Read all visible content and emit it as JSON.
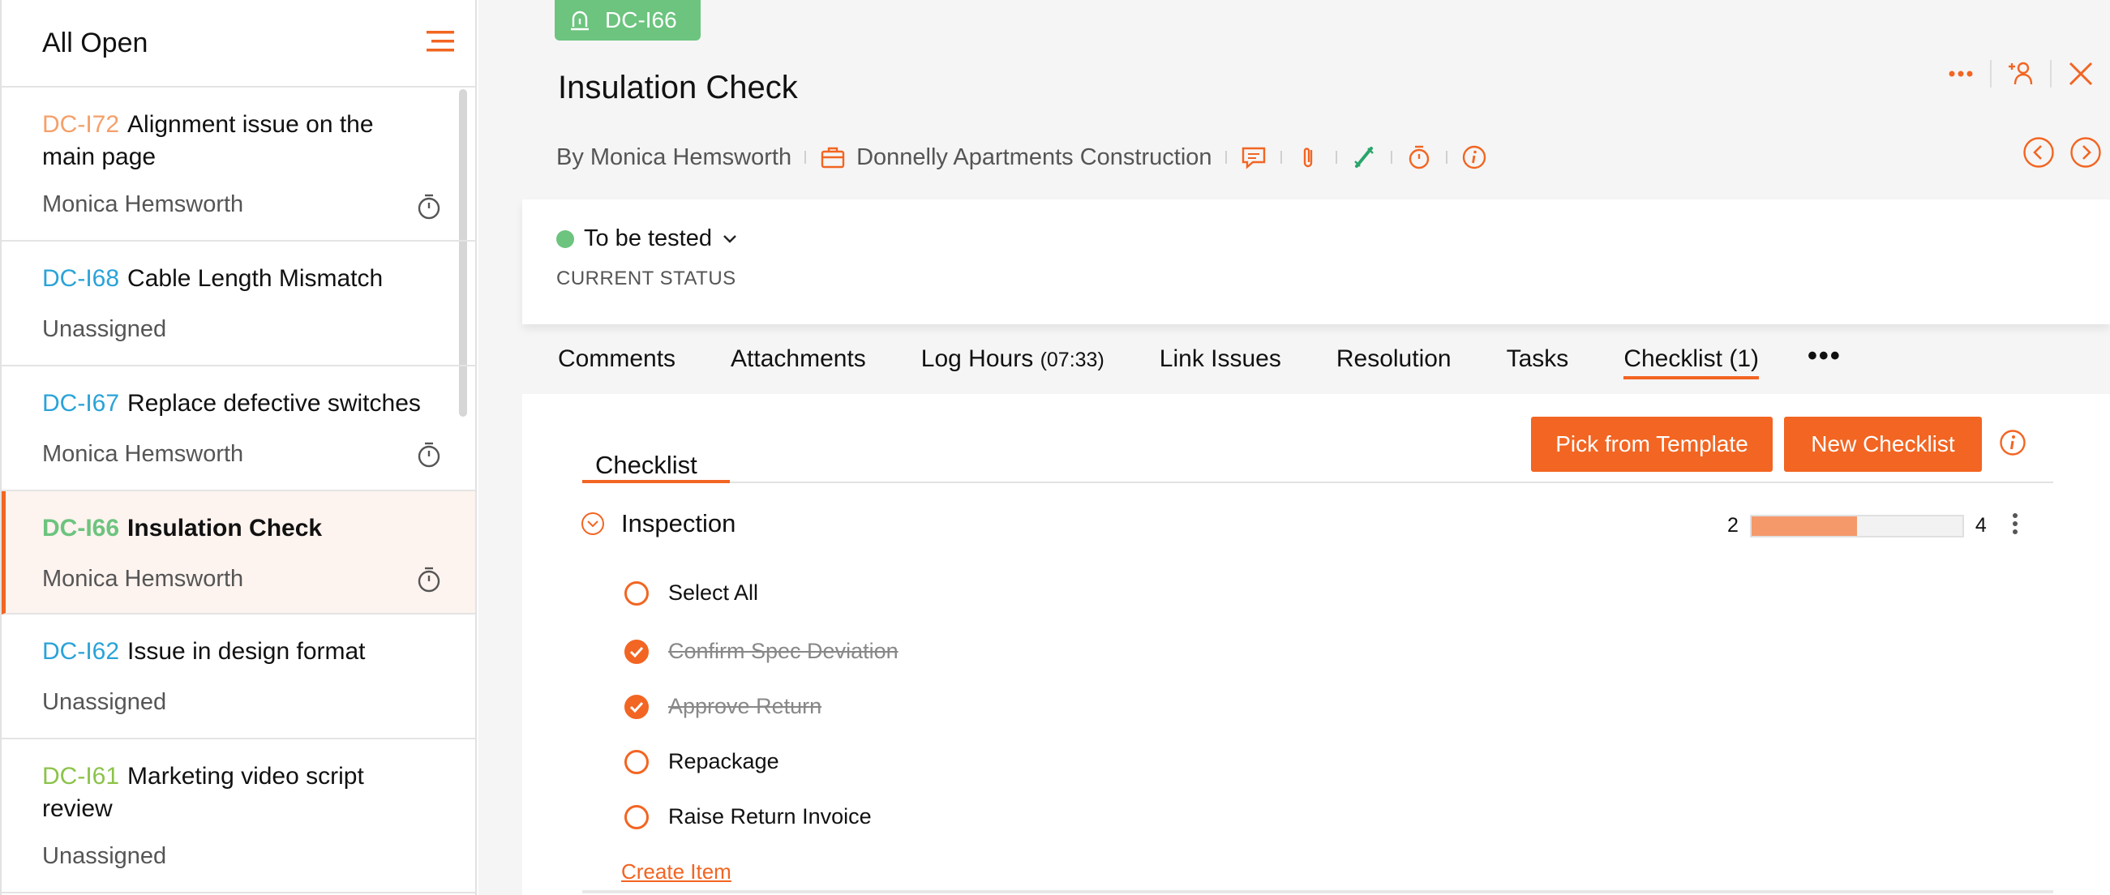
{
  "sidebar": {
    "title": "All Open",
    "items": [
      {
        "code": "DC-I72",
        "code_color": "#f5a06a",
        "title": "Alignment issue on the main page",
        "assignee": "Monica Hemsworth",
        "timer": true
      },
      {
        "code": "DC-I68",
        "code_color": "#2aa3d8",
        "title": "Cable Length Mismatch",
        "assignee": "Unassigned",
        "timer": false
      },
      {
        "code": "DC-I67",
        "code_color": "#2aa3d8",
        "title": "Replace defective switches",
        "assignee": "Monica Hemsworth",
        "timer": true
      },
      {
        "code": "DC-I66",
        "code_color": "#6cc47e",
        "title": "Insulation Check",
        "assignee": "Monica Hemsworth",
        "timer": true,
        "selected": true
      },
      {
        "code": "DC-I62",
        "code_color": "#2aa3d8",
        "title": "Issue in design format",
        "assignee": "Unassigned",
        "timer": false
      },
      {
        "code": "DC-I61",
        "code_color": "#8cc34a",
        "title": "Marketing video script review",
        "assignee": "Unassigned",
        "timer": false
      }
    ]
  },
  "issue": {
    "badge": "DC-I66",
    "title": "Insulation Check",
    "author": "By Monica Hemsworth",
    "project": "Donnelly Apartments Construction"
  },
  "status": {
    "value": "To be tested",
    "label": "CURRENT STATUS"
  },
  "tabs": {
    "comments": "Comments",
    "attachments": "Attachments",
    "log_hours": "Log Hours",
    "log_hours_count": "(07:33)",
    "link_issues": "Link Issues",
    "resolution": "Resolution",
    "tasks": "Tasks",
    "checklist": "Checklist (1)",
    "more": "•••"
  },
  "checklist": {
    "heading": "Checklist",
    "pick_button": "Pick from Template",
    "new_button": "New Checklist",
    "group": "Inspection",
    "progress_done": "2",
    "progress_total": "4",
    "progress_fraction": 0.5,
    "select_all": "Select All",
    "items": [
      {
        "label": "Confirm Spec Deviation",
        "done": true
      },
      {
        "label": "Approve Return",
        "done": true
      },
      {
        "label": "Repackage",
        "done": false
      },
      {
        "label": "Raise Return Invoice",
        "done": false
      }
    ],
    "create_item": "Create Item"
  },
  "colors": {
    "accent": "#f26522",
    "status_green": "#6cc47e"
  }
}
